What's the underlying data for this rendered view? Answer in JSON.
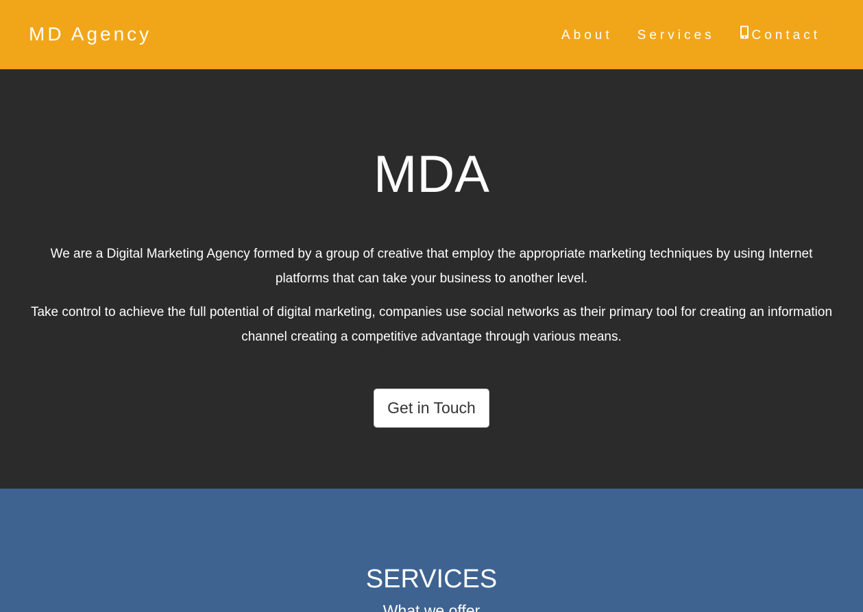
{
  "navbar": {
    "brand": "MD Agency",
    "links": [
      {
        "label": "About"
      },
      {
        "label": "Services"
      },
      {
        "label": "Contact",
        "icon": "mobile-phone-icon"
      }
    ],
    "background_color": "#f1a619"
  },
  "hero": {
    "title": "MDA",
    "paragraphs": [
      "We are a Digital Marketing Agency formed by a group of creative that employ the appropriate marketing techniques by using Internet platforms that can take your business to another level.",
      "Take control to achieve the full potential of digital marketing, companies use social networks as their primary tool for creating an information channel creating a competitive advantage through various means."
    ],
    "cta_label": "Get in Touch",
    "background_color": "#2b2b2b"
  },
  "services": {
    "title": "SERVICES",
    "subtitle": "What we offer",
    "background_color": "#3e6391"
  }
}
